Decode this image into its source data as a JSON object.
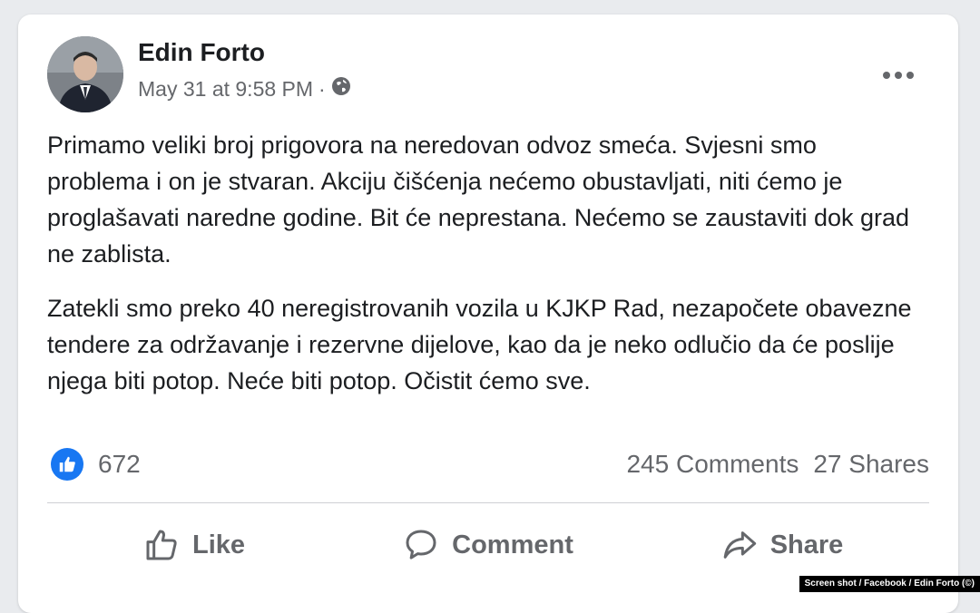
{
  "post": {
    "author": "Edin Forto",
    "timestamp": "May 31 at 9:58 PM",
    "separator": "·",
    "audience_icon": "globe-icon",
    "more_icon": "more-options-icon",
    "paragraphs": [
      "Primamo veliki broj prigovora na neredovan odvoz smeća. Svjesni smo problema i on je stvaran. Akciju čišćenja nećemo obustavljati, niti ćemo je proglašavati naredne godine. Bit će neprestana. Nećemo se zaustaviti dok grad ne zablista.",
      "Zatekli smo preko 40 neregistrovanih vozila u KJKP Rad, nezapočete obavezne tendere za održavanje i rezervne dijelove, kao da je neko odlučio da će poslije njega biti potop. Neće biti potop. Očistit ćemo sve."
    ]
  },
  "stats": {
    "reaction_count": "672",
    "comments": "245 Comments",
    "shares": "27 Shares"
  },
  "actions": {
    "like_label": "Like",
    "comment_label": "Comment",
    "share_label": "Share"
  },
  "credit": "Screen shot / Facebook / Edin Forto (©)",
  "colors": {
    "like_blue": "#1877f2",
    "secondary_text": "#65676b",
    "background": "#e9ebee"
  }
}
